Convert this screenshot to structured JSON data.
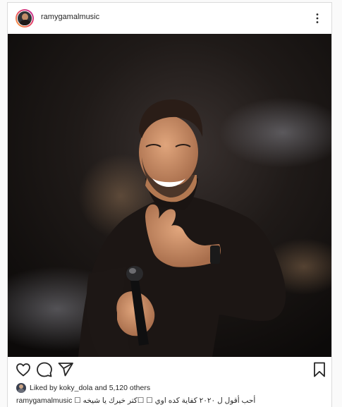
{
  "post": {
    "username": "ramygamalmusic",
    "more_icon": "more-horizontal-icon",
    "image_alt": "Man in black turtleneck smiling and waving on stage holding a microphone"
  },
  "actions": {
    "like_icon": "heart-icon",
    "comment_icon": "comment-icon",
    "share_icon": "send-icon",
    "save_icon": "bookmark-icon"
  },
  "likes": {
    "prefix": "Liked by",
    "user": "koky_dola",
    "middle": "and",
    "count": "5,120 others"
  },
  "caption": {
    "username": "ramygamalmusic",
    "text": "أحب أقول ل ٢٠٢٠ كفاية كده اوي ☐ ☐كتر خيرك يا شيخه ☐"
  },
  "colors": {
    "text": "#262626",
    "border": "#dbdbdb",
    "background": "#fafafa"
  }
}
